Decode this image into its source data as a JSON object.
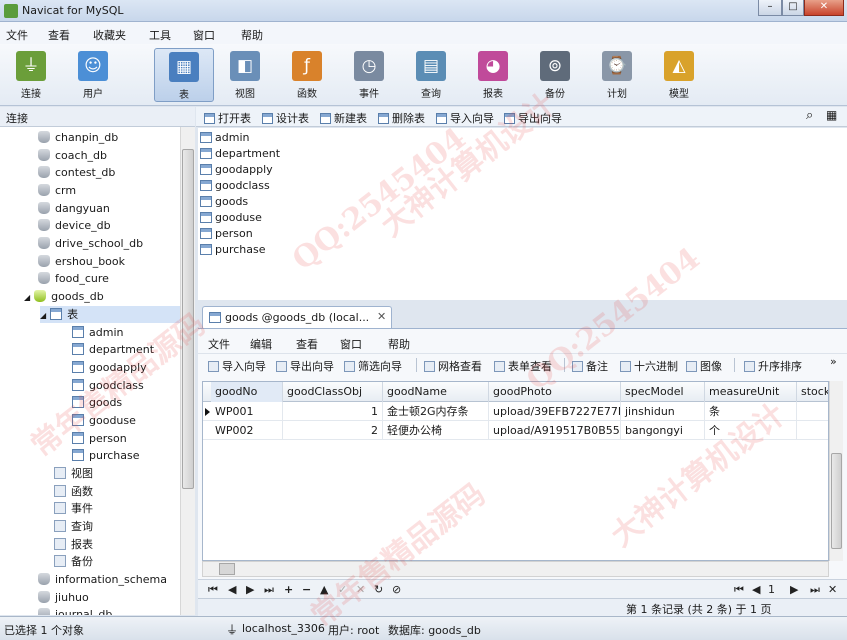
{
  "window": {
    "title": "Navicat for MySQL",
    "minimize": "–",
    "maximize": "□",
    "close": "✕"
  },
  "menu": [
    "文件",
    "查看",
    "收藏夹",
    "工具",
    "窗口",
    "帮助"
  ],
  "toolbar": [
    {
      "label": "连接",
      "icon": "connection-icon",
      "color": "#6b9e3a"
    },
    {
      "label": "用户",
      "icon": "user-icon",
      "color": "#4c8fd6"
    },
    {
      "label": "表",
      "icon": "table-icon",
      "color": "#4a7fbf"
    },
    {
      "label": "视图",
      "icon": "view-icon",
      "color": "#6a8fb8"
    },
    {
      "label": "函数",
      "icon": "function-icon",
      "color": "#d9822b"
    },
    {
      "label": "事件",
      "icon": "event-icon",
      "color": "#7a8aa0"
    },
    {
      "label": "查询",
      "icon": "query-icon",
      "color": "#5b8db5"
    },
    {
      "label": "报表",
      "icon": "report-icon",
      "color": "#c04a9a"
    },
    {
      "label": "备份",
      "icon": "backup-icon",
      "color": "#5f6b7a"
    },
    {
      "label": "计划",
      "icon": "schedule-icon",
      "color": "#8a97a8"
    },
    {
      "label": "模型",
      "icon": "model-icon",
      "color": "#d9a22b"
    }
  ],
  "left_panel": {
    "title": "连接"
  },
  "tree": {
    "databases_above": [
      "chanpin_db",
      "coach_db",
      "contest_db",
      "crm",
      "dangyuan",
      "device_db",
      "drive_school_db",
      "ershou_book",
      "food_cure"
    ],
    "open_db": "goods_db",
    "tables_node": "表",
    "tables": [
      "admin",
      "department",
      "goodapply",
      "goodclass",
      "goods",
      "gooduse",
      "person",
      "purchase"
    ],
    "other_nodes": [
      "视图",
      "函数",
      "事件",
      "查询",
      "报表",
      "备份"
    ],
    "databases_below": [
      "information_schema",
      "jiuhuo",
      "journal_db"
    ]
  },
  "object_toolbar": {
    "open": "打开表",
    "design": "设计表",
    "new": "新建表",
    "delete": "删除表",
    "import": "导入向导",
    "export": "导出向导"
  },
  "object_list": [
    "admin",
    "department",
    "goodapply",
    "goodclass",
    "goods",
    "gooduse",
    "person",
    "purchase"
  ],
  "tab": {
    "label": "goods @goods_db (local...",
    "close": "✕"
  },
  "table_menu": [
    "文件",
    "编辑",
    "查看",
    "窗口",
    "帮助"
  ],
  "table_toolbar": {
    "import": "导入向导",
    "export": "导出向导",
    "filter": "筛选向导",
    "grid_view": "网格查看",
    "form_view": "表单查看",
    "memo": "备注",
    "hex": "十六进制",
    "image": "图像",
    "sort_asc": "升序排序",
    "more": "»"
  },
  "grid": {
    "columns": [
      "goodNo",
      "goodClassObj",
      "goodName",
      "goodPhoto",
      "specModel",
      "measureUnit",
      "stock"
    ],
    "rows": [
      [
        "WP001",
        "1",
        "金士顿2G内存条",
        "upload/39EFB7227E77DF",
        "jinshidun",
        "条",
        ""
      ],
      [
        "WP002",
        "2",
        "轻便办公椅",
        "upload/A919517B0B55DI",
        "bangongyi",
        "个",
        ""
      ]
    ]
  },
  "navbar": {
    "page": "1"
  },
  "record_info": "第 1 条记录 (共 2 条) 于 1 页",
  "status": {
    "selected": "已选择 1 个对象",
    "connection": "localhost_3306",
    "user": "用户: root",
    "database": "数据库: goods_db"
  },
  "watermarks": [
    "QQ:2545404",
    "常年售精品源码",
    "大神计算机设计",
    "QQ:2545404",
    "常年售精品源码",
    "大神计算机设计"
  ]
}
